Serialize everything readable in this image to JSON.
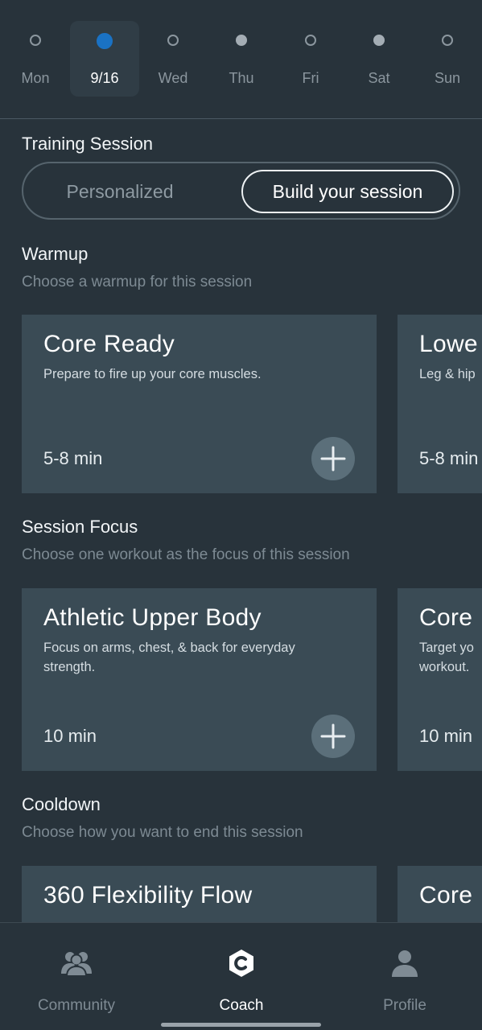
{
  "days": [
    {
      "label": "Mon",
      "state": "empty"
    },
    {
      "label": "9/16",
      "state": "active"
    },
    {
      "label": "Wed",
      "state": "empty"
    },
    {
      "label": "Thu",
      "state": "filled"
    },
    {
      "label": "Fri",
      "state": "empty"
    },
    {
      "label": "Sat",
      "state": "filled"
    },
    {
      "label": "Sun",
      "state": "empty"
    }
  ],
  "training": {
    "title": "Training Session",
    "option_personalized": "Personalized",
    "option_build": "Build your session",
    "selected_option": "Build your session"
  },
  "warmup": {
    "title": "Warmup",
    "subtitle": "Choose a warmup for this session",
    "cards": [
      {
        "title": "Core Ready",
        "description": "Prepare to fire up your core muscles.",
        "duration": "5-8 min"
      },
      {
        "title": "Lowe",
        "description": "Leg & hip",
        "duration": "5-8 min"
      }
    ]
  },
  "focus": {
    "title": "Session Focus",
    "subtitle": "Choose one workout as the focus of this session",
    "cards": [
      {
        "title": "Athletic Upper Body",
        "description": "Focus on arms, chest, & back for everyday strength.",
        "duration": "10 min"
      },
      {
        "title": "Core",
        "description_line1": "Target yo",
        "description_line2": "workout.",
        "duration": "10 min"
      }
    ]
  },
  "cooldown": {
    "title": "Cooldown",
    "subtitle": "Choose how you want to end this session",
    "cards": [
      {
        "title": "360 Flexibility Flow"
      },
      {
        "title": "Core"
      }
    ]
  },
  "nav": {
    "community": "Community",
    "coach": "Coach",
    "profile": "Profile",
    "active": "Coach"
  },
  "colors": {
    "background": "#28333b",
    "card": "#3a4b55",
    "accent_dot": "#1a72c4",
    "add_button": "#5b6f7a"
  }
}
